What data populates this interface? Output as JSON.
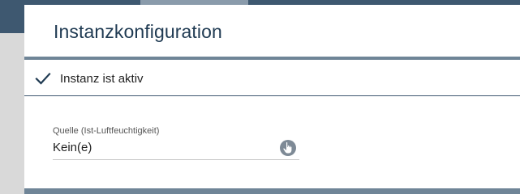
{
  "panel": {
    "title": "Instanzkonfiguration"
  },
  "active_toggle": {
    "label": "Instanz ist aktiv",
    "checked": true,
    "icon": "check-icon"
  },
  "source_field": {
    "label": "Quelle (Ist-Luftfeuchtigkeit)",
    "value": "Kein(e)",
    "icon": "hand-pointer-icon"
  },
  "colors": {
    "header_bar": "#3e5870",
    "title_text": "#1f3a52",
    "divider": "#6f8597",
    "icon_button": "#7e8a96"
  }
}
